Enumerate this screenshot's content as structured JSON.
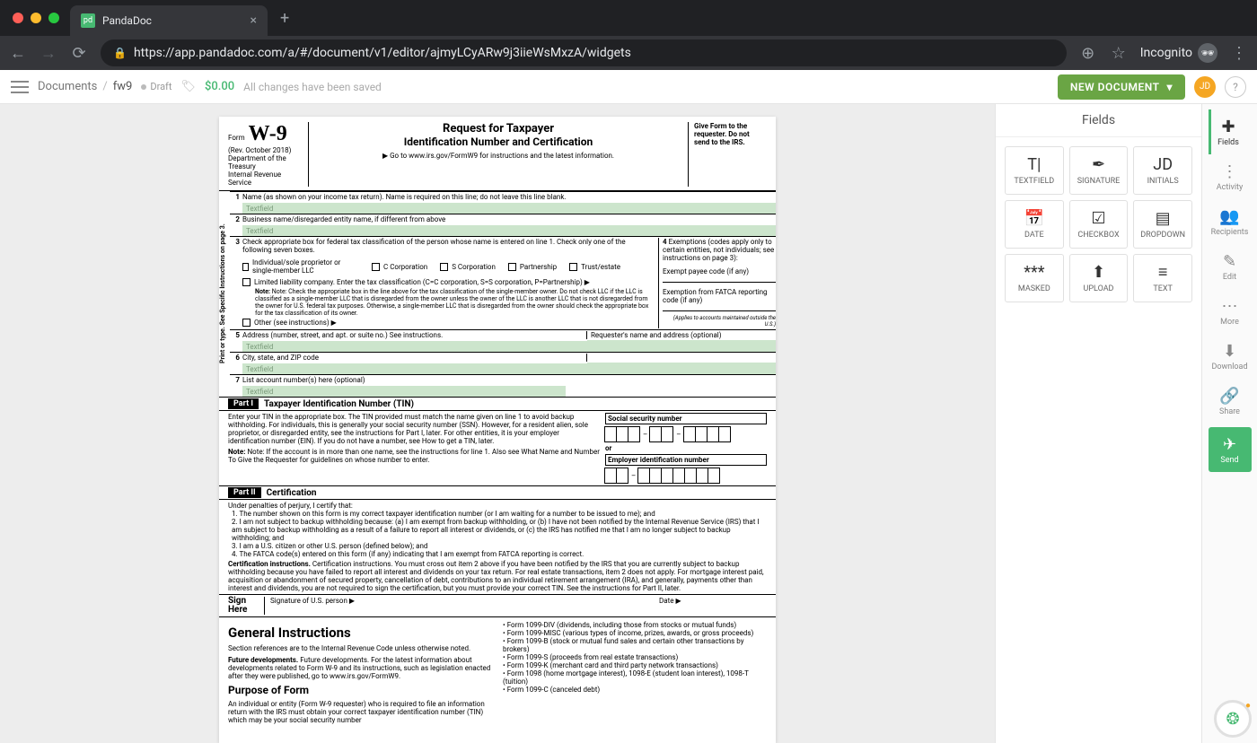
{
  "browser": {
    "tab_title": "PandaDoc",
    "url": "https://app.pandadoc.com/a/#/document/v1/editor/ajmyLCyARw9j3iieWsMxzA/widgets",
    "incognito_label": "Incognito"
  },
  "appbar": {
    "crumb_root": "Documents",
    "crumb_name": "fw9",
    "status": "Draft",
    "price": "$0.00",
    "save_status": "All changes have been saved",
    "new_doc": "NEW DOCUMENT",
    "avatar": "JD"
  },
  "fields_panel": {
    "title": "Fields",
    "tiles": [
      {
        "label": "TEXTFIELD",
        "glyph": "T|"
      },
      {
        "label": "SIGNATURE",
        "glyph": "✒"
      },
      {
        "label": "INITIALS",
        "glyph": "JD"
      },
      {
        "label": "DATE",
        "glyph": "📅"
      },
      {
        "label": "CHECKBOX",
        "glyph": "☑"
      },
      {
        "label": "DROPDOWN",
        "glyph": "▤"
      },
      {
        "label": "MASKED",
        "glyph": "***"
      },
      {
        "label": "UPLOAD",
        "glyph": "⬆"
      },
      {
        "label": "TEXT",
        "glyph": "≡"
      }
    ]
  },
  "rail": {
    "items": [
      {
        "label": "Fields",
        "glyph": "✚"
      },
      {
        "label": "Activity",
        "glyph": "⋮"
      },
      {
        "label": "Recipients",
        "glyph": "👥"
      },
      {
        "label": "Edit",
        "glyph": "✎"
      },
      {
        "label": "More",
        "glyph": "⋯"
      },
      {
        "label": "Download",
        "glyph": "⬇"
      },
      {
        "label": "Share",
        "glyph": "🔗"
      }
    ],
    "send": "Send"
  },
  "w9": {
    "form_label": "Form",
    "form_no": "W-9",
    "rev": "(Rev. October 2018)",
    "dept": "Department of the Treasury",
    "irs": "Internal Revenue Service",
    "title1": "Request for Taxpayer",
    "title2": "Identification Number and Certification",
    "goto": "▶ Go to www.irs.gov/FormW9 for instructions and the latest information.",
    "giveform": "Give Form to the requester. Do not send to the IRS.",
    "side": "Print or type.   See Specific Instructions on page 3.",
    "line1": "Name (as shown on your income tax return). Name is required on this line; do not leave this line blank.",
    "line2": "Business name/disregarded entity name, if different from above",
    "line3": "Check appropriate box for federal tax classification of the person whose name is entered on line 1. Check only one of the following seven boxes.",
    "line3_opts": [
      "Individual/sole proprietor or single-member LLC",
      "C Corporation",
      "S Corporation",
      "Partnership",
      "Trust/estate",
      "Limited liability company. Enter the tax classification (C=C corporation, S=S corporation, P=Partnership) ▶",
      "Other (see instructions) ▶"
    ],
    "line3_note": "Note: Check the appropriate box in the line above for the tax classification of the single-member owner. Do not check LLC if the LLC is classified as a single-member LLC that is disregarded from the owner unless the owner of the LLC is another LLC that is not disregarded from the owner for U.S. federal tax purposes. Otherwise, a single-member LLC that is disregarded from the owner should check the appropriate box for the tax classification of its owner.",
    "line4": "Exemptions (codes apply only to certain entities, not individuals; see instructions on page 3):",
    "line4a": "Exempt payee code (if any)",
    "line4b": "Exemption from FATCA reporting code (if any)",
    "line4c": "(Applies to accounts maintained outside the U.S.)",
    "line5": "Address (number, street, and apt. or suite no.) See instructions.",
    "line5r": "Requester's name and address (optional)",
    "line6": "City, state, and ZIP code",
    "line7": "List account number(s) here (optional)",
    "tf": "Textfield",
    "part1": "Part I",
    "part1_title": "Taxpayer Identification Number (TIN)",
    "part1_text": "Enter your TIN in the appropriate box. The TIN provided must match the name given on line 1 to avoid backup withholding. For individuals, this is generally your social security number (SSN). However, for a resident alien, sole proprietor, or disregarded entity, see the instructions for Part I, later. For other entities, it is your employer identification number (EIN). If you do not have a number, see How to get a TIN, later.",
    "part1_note": "Note: If the account is in more than one name, see the instructions for line 1. Also see What Name and Number To Give the Requester for guidelines on whose number to enter.",
    "ssn_label": "Social security number",
    "or": "or",
    "ein_label": "Employer identification number",
    "part2": "Part II",
    "part2_title": "Certification",
    "part2_intro": "Under penalties of perjury, I certify that:",
    "cert_items": [
      "The number shown on this form is my correct taxpayer identification number (or I am waiting for a number to be issued to me); and",
      "I am not subject to backup withholding because: (a) I am exempt from backup withholding, or (b) I have not been notified by the Internal Revenue Service (IRS) that I am subject to backup withholding as a result of a failure to report all interest or dividends, or (c) the IRS has notified me that I am no longer subject to backup withholding; and",
      "I am a U.S. citizen or other U.S. person (defined below); and",
      "The FATCA code(s) entered on this form (if any) indicating that I am exempt from FATCA reporting is correct."
    ],
    "cert_instr": "Certification instructions. You must cross out item 2 above if you have been notified by the IRS that you are currently subject to backup withholding because you have failed to report all interest and dividends on your tax return. For real estate transactions, item 2 does not apply. For mortgage interest paid, acquisition or abandonment of secured property, cancellation of debt, contributions to an individual retirement arrangement (IRA), and generally, payments other than interest and dividends, you are not required to sign the certification, but you must provide your correct TIN. See the instructions for Part II, later.",
    "sign_here": "Sign Here",
    "sign_of": "Signature of U.S. person ▶",
    "date": "Date ▶",
    "gen_title": "General Instructions",
    "gen_p1": "Section references are to the Internal Revenue Code unless otherwise noted.",
    "gen_p2": "Future developments. For the latest information about developments related to Form W-9 and its instructions, such as legislation enacted after they were published, go to www.irs.gov/FormW9.",
    "purpose_title": "Purpose of Form",
    "purpose_p": "An individual or entity (Form W-9 requester) who is required to file an information return with the IRS must obtain your correct taxpayer identification number (TIN) which may be your social security number",
    "bullets": [
      "Form 1099-DIV (dividends, including those from stocks or mutual funds)",
      "Form 1099-MISC (various types of income, prizes, awards, or gross proceeds)",
      "Form 1099-B (stock or mutual fund sales and certain other transactions by brokers)",
      "Form 1099-S (proceeds from real estate transactions)",
      "Form 1099-K (merchant card and third party network transactions)",
      "Form 1098 (home mortgage interest), 1098-E (student loan interest), 1098-T (tuition)",
      "Form 1099-C (canceled debt)"
    ]
  }
}
